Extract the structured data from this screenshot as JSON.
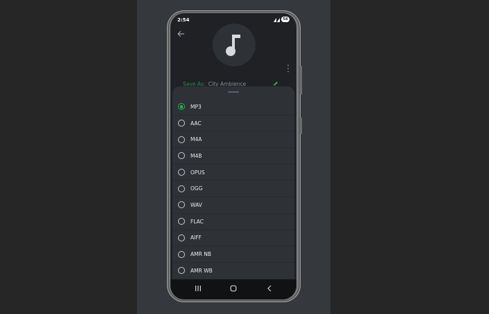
{
  "status_bar": {
    "time": "2:54",
    "battery": "56"
  },
  "header": {
    "save_as_label": "Save As:",
    "save_as_value": "City Ambience"
  },
  "format_sheet": {
    "selected": "MP3",
    "options": [
      {
        "label": "MP3",
        "checked": true
      },
      {
        "label": "AAC",
        "checked": false
      },
      {
        "label": "M4A",
        "checked": false
      },
      {
        "label": "M4B",
        "checked": false
      },
      {
        "label": "OPUS",
        "checked": false
      },
      {
        "label": "OGG",
        "checked": false
      },
      {
        "label": "WAV",
        "checked": false
      },
      {
        "label": "FLAC",
        "checked": false
      },
      {
        "label": "AIFF",
        "checked": false
      },
      {
        "label": "AMR NB",
        "checked": false
      },
      {
        "label": "AMR WB",
        "checked": false
      }
    ]
  },
  "icons": {
    "back": "arrow-left-icon",
    "art": "music-note-icon",
    "more": "more-vertical-icon",
    "edit": "pencil-icon",
    "nav_recent": "recent-apps-icon",
    "nav_home": "home-icon",
    "nav_back": "chevron-left-icon"
  },
  "colors": {
    "accent": "#22b24c",
    "save_label": "#2e8b4e",
    "sheet_bg": "#2e3237"
  }
}
